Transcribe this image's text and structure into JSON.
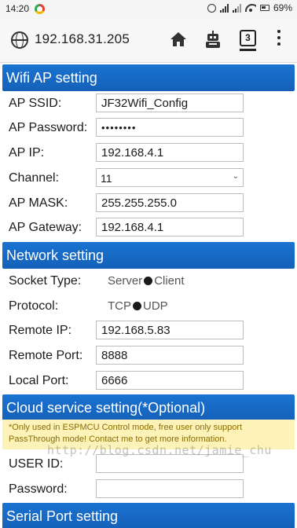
{
  "status_bar": {
    "time": "14:20",
    "battery": "69%",
    "icons": [
      "notification-app-icon",
      "alarm-icon",
      "signal-icon",
      "signal-icon",
      "wifi-icon",
      "battery-icon"
    ]
  },
  "browser": {
    "url": "192.168.31.205",
    "tab_count": "3",
    "icons": [
      "globe-icon",
      "home-icon",
      "robot-icon",
      "tabs-icon",
      "more-vert-icon"
    ]
  },
  "wifi_ap": {
    "title": "Wifi AP setting",
    "ssid_label": "AP SSID:",
    "ssid_value": "JF32Wifi_Config",
    "password_label": "AP Password:",
    "password_value": "••••••••",
    "ip_label": "AP IP:",
    "ip_value": "192.168.4.1",
    "channel_label": "Channel:",
    "channel_value": "11",
    "mask_label": "AP MASK:",
    "mask_value": "255.255.255.0",
    "gateway_label": "AP Gateway:",
    "gateway_value": "192.168.4.1"
  },
  "network": {
    "title": "Network setting",
    "socket_label": "Socket Type:",
    "socket_options": [
      "Server",
      "Client"
    ],
    "socket_selected": "Client",
    "protocol_label": "Protocol:",
    "protocol_options": [
      "TCP",
      "UDP"
    ],
    "protocol_selected": "UDP",
    "remote_ip_label": "Remote IP:",
    "remote_ip_value": "192.168.5.83",
    "remote_port_label": "Remote Port:",
    "remote_port_value": "8888",
    "local_port_label": "Local Port:",
    "local_port_value": "6666"
  },
  "cloud": {
    "title": "Cloud service setting(*Optional)",
    "notice_line1": "*Only used in ESPMCU Control mode, free user only support",
    "notice_line2": "PassThrough mode! Contact me to get more information.",
    "user_id_label": "USER ID:",
    "user_id_value": "",
    "password_label": "Password:",
    "password_value": ""
  },
  "serial": {
    "title": "Serial Port setting"
  },
  "watermark": "http://blog.csdn.net/jamie_chu",
  "colors": {
    "header_blue": "#1a73d1",
    "notice_bg": "#fdf3b8",
    "notice_text": "#8a6d00"
  }
}
